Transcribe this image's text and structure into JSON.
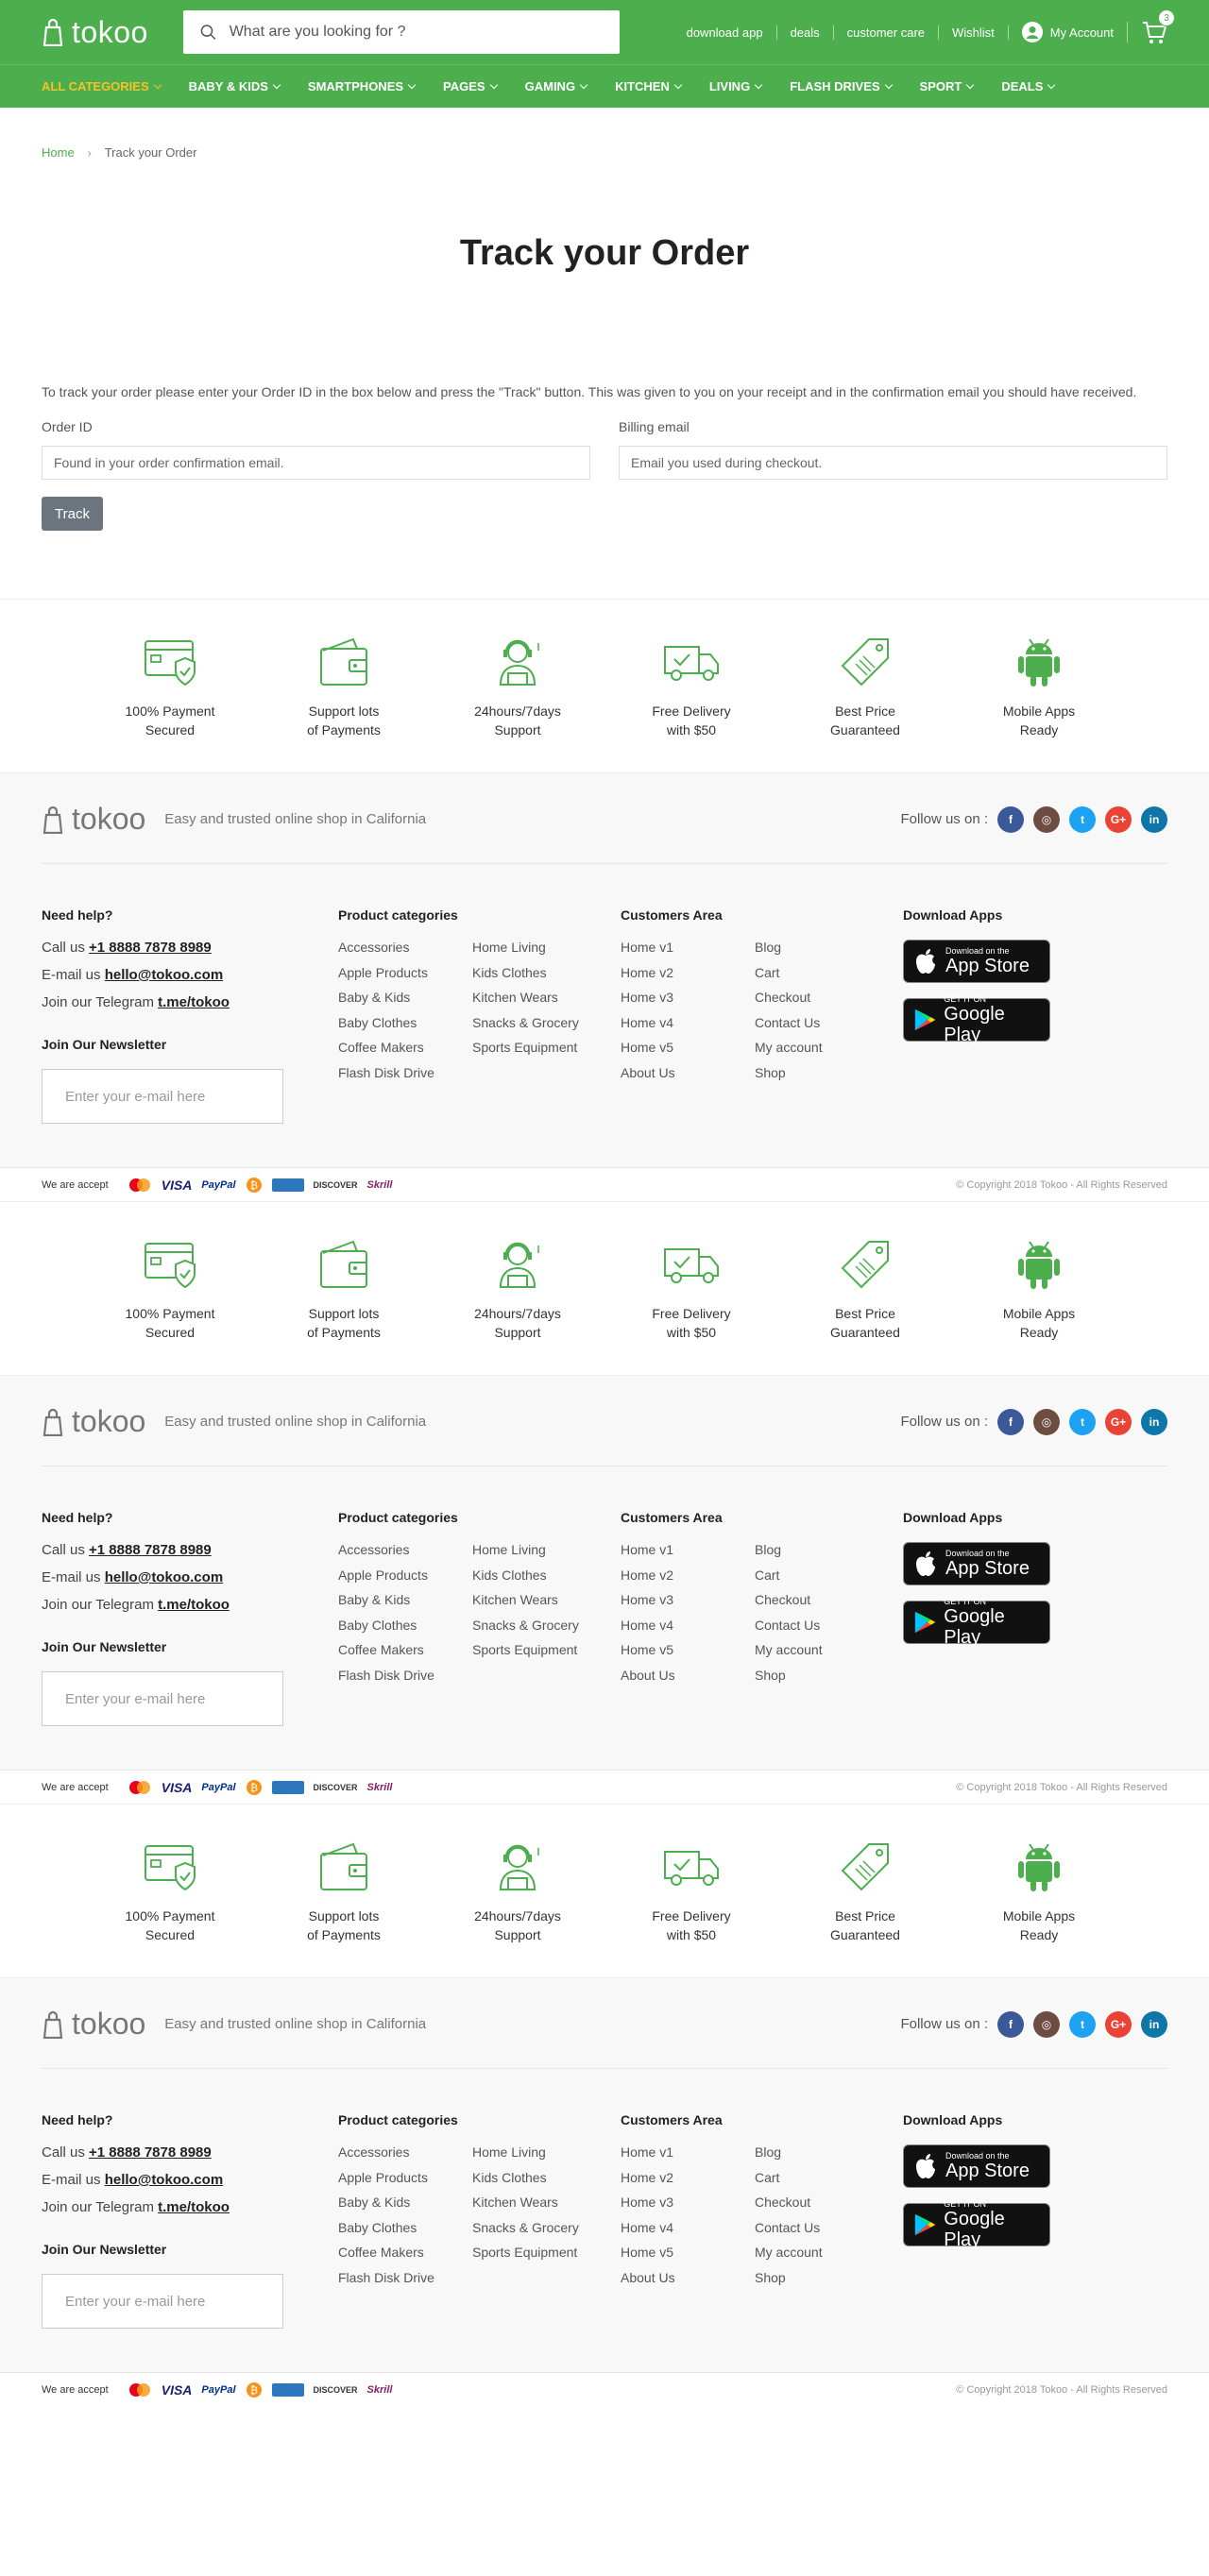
{
  "header": {
    "logo": "tokoo",
    "search_placeholder": "What are you looking for ?",
    "links": [
      "download app",
      "deals",
      "customer care",
      "Wishlist"
    ],
    "account": "My Account",
    "cart_count": "3"
  },
  "nav": [
    {
      "label": "ALL CATEGORIES",
      "active": true
    },
    {
      "label": "BABY & KIDS"
    },
    {
      "label": "SMARTPHONES"
    },
    {
      "label": "PAGES"
    },
    {
      "label": "GAMING"
    },
    {
      "label": "KITCHEN"
    },
    {
      "label": "LIVING"
    },
    {
      "label": "FLASH DRIVES"
    },
    {
      "label": "SPORT"
    },
    {
      "label": "DEALS"
    }
  ],
  "breadcrumb": {
    "home": "Home",
    "current": "Track your Order"
  },
  "page": {
    "title": "Track your Order",
    "intro": "To track your order please enter your Order ID in the box below and press the \"Track\" button. This was given to you on your receipt and in the confirmation email you should have received.",
    "order_label": "Order ID",
    "order_placeholder": "Found in your order confirmation email.",
    "email_label": "Billing email",
    "email_placeholder": "Email you used during checkout.",
    "track_button": "Track"
  },
  "features": [
    {
      "label": "100% Payment\nSecured",
      "icon": "card-shield-icon"
    },
    {
      "label": "Support lots\nof Payments",
      "icon": "wallet-icon"
    },
    {
      "label": "24hours/7days\nSupport",
      "icon": "headset-agent-icon"
    },
    {
      "label": "Free Delivery\nwith $50",
      "icon": "truck-icon"
    },
    {
      "label": "Best Price\nGuaranteed",
      "icon": "price-tag-icon"
    },
    {
      "label": "Mobile Apps\nReady",
      "icon": "android-icon"
    }
  ],
  "footer": {
    "logo": "tokoo",
    "tagline": "Easy and trusted online shop in California",
    "follow": "Follow us on :",
    "social_colors": {
      "facebook": "#3b5998",
      "instagram": "#6d4c41",
      "twitter": "#1da1f2",
      "google": "#ea4335",
      "linkedin": "#0e76a8"
    },
    "help_title": "Need help?",
    "call_prefix": "Call us ",
    "phone": "+1 8888 7878 8989",
    "email_prefix": "E-mail us ",
    "email": "hello@tokoo.com",
    "telegram_prefix": "Join our Telegram ",
    "telegram": "t.me/tokoo",
    "newsletter_title": "Join Our Newsletter",
    "newsletter_placeholder": "Enter your e-mail here",
    "categories_title": "Product categories",
    "categories_a": [
      "Accessories",
      "Apple Products",
      "Baby & Kids",
      "Baby Clothes",
      "Coffee Makers",
      "Flash Disk Drive"
    ],
    "categories_b": [
      "Home Living",
      "Kids Clothes",
      "Kitchen Wears",
      "Snacks & Grocery",
      "Sports Equipment"
    ],
    "customers_title": "Customers Area",
    "customers_a": [
      "Home v1",
      "Home v2",
      "Home v3",
      "Home v4",
      "Home v5",
      "About Us"
    ],
    "customers_b": [
      "Blog",
      "Cart",
      "Checkout",
      "Contact Us",
      "My account",
      "Shop"
    ],
    "apps_title": "Download Apps",
    "appstore_small": "Download on the",
    "appstore_big": "App Store",
    "googleplay_small": "GET IT ON",
    "googleplay_big": "Google Play",
    "accept": "We are accept",
    "payments": [
      "VISA",
      "PayPal",
      "DISCOVER",
      "Skrill"
    ],
    "copyright": "© Copyright 2018 Tokoo - All Rights Reserved"
  },
  "accent_color": "#4cae4c"
}
